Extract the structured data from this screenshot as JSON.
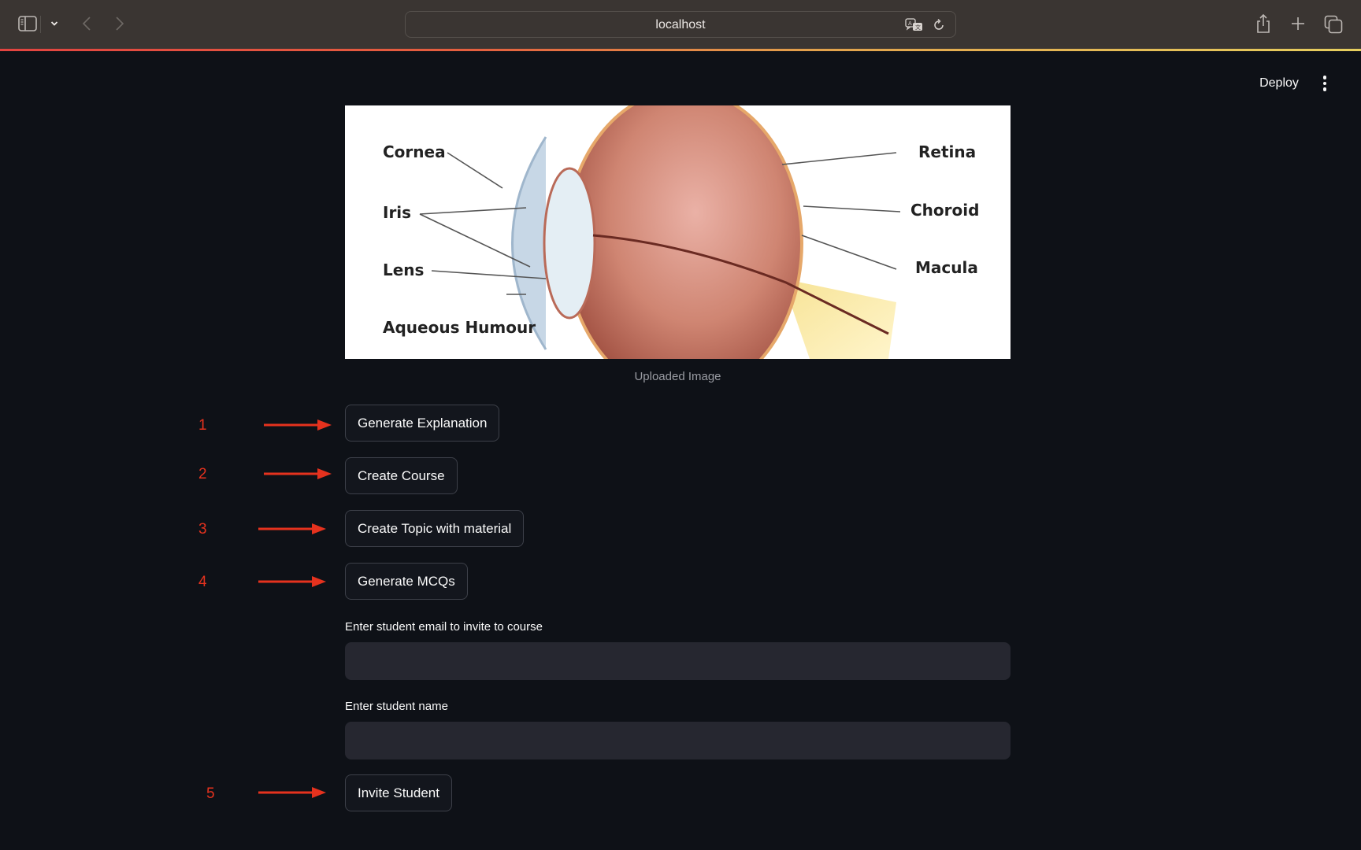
{
  "browser": {
    "url": "localhost",
    "icons": {
      "sidebar_toggle": "sidebar-icon",
      "sidebar_dropdown": "chevron-down-icon",
      "back": "chevron-left-icon",
      "forward": "chevron-right-icon",
      "translate": "translate-icon",
      "reload": "reload-icon",
      "share": "share-icon",
      "new_tab": "plus-icon",
      "tab_overview": "tabs-icon"
    },
    "loading_bar_colors": [
      "#e24440",
      "#e2a24c",
      "#e6cf5f"
    ]
  },
  "app_header": {
    "deploy_label": "Deploy",
    "menu_icon": "kebab-menu-icon"
  },
  "image": {
    "caption": "Uploaded Image",
    "alt": "Eye anatomy diagram",
    "labels_left": [
      "Cornea",
      "Iris",
      "Lens",
      "Aqueous Humour"
    ],
    "labels_right": [
      "Retina",
      "Choroid",
      "Macula"
    ]
  },
  "buttons": {
    "generate_explanation": "Generate Explanation",
    "create_course": "Create Course",
    "create_topic": "Create Topic with material",
    "generate_mcqs": "Generate MCQs",
    "invite_student": "Invite Student"
  },
  "form": {
    "email_label": "Enter student email to invite to course",
    "email_value": "",
    "name_label": "Enter student name",
    "name_value": ""
  },
  "annotations": {
    "color": "#e5321e",
    "markers": [
      "1",
      "2",
      "3",
      "4",
      "5"
    ]
  }
}
